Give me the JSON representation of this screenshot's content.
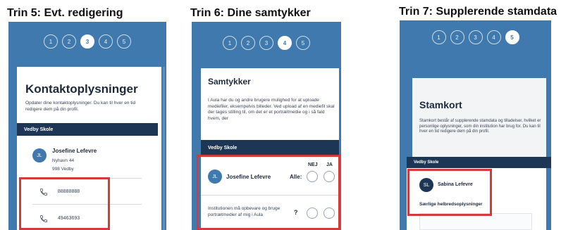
{
  "panels": [
    {
      "step_title": "Trin 5: Evt. redigering",
      "steps": [
        "1",
        "2",
        "3",
        "4",
        "5"
      ],
      "active_step": "3",
      "card_title": "Kontaktoplysninger",
      "card_body": "Opdater dine kontaktoplysninger. Du kan til hver en tid redigere dem på din profil.",
      "school": "Vedby Skole",
      "avatar_initials": "JL",
      "name": "Josefine Lefevre",
      "address_line1": "Nyhavn 44",
      "address_line2": "998 Vedby",
      "phone_numbers": [
        "88888888",
        "49463693"
      ],
      "icons": [
        "phone-icon",
        "phone-icon"
      ]
    },
    {
      "step_title": "Trin 6: Dine samtykker",
      "steps": [
        "1",
        "2",
        "3",
        "4",
        "5"
      ],
      "active_step": "4",
      "card_title": "Samtykker",
      "card_body": "I Aula har du og andre brugere mulighed for at uploade mediefiler, eksempelvis billeder. Ved upload af en mediefil skal der tages stilling til, om det er et portrætmedie og i så fald hvem, der",
      "school": "Vedby Skole",
      "col_no": "NEJ",
      "col_yes": "JA",
      "avatar_initials": "JL",
      "name": "Josefine Lefevre",
      "all_label": "Alle:",
      "question": "Institutionen må opbevare og bruge portrætmedier af mig i Aula",
      "question_mark": "?"
    },
    {
      "step_title": "Trin 7: Supplerende stamdata",
      "steps": [
        "1",
        "2",
        "3",
        "4",
        "5"
      ],
      "active_step": "5",
      "card_title": "Stamkort",
      "card_body": "Stamkort består af supplerende stamdata og tilladelser, hvilket er personlige oplysninger, som din institution har brug for. Du kan til hver en tid redigere dem på din profil.",
      "school": "Vedby Skole",
      "avatar_initials": "SL",
      "name": "Sabina Lefevre",
      "section": "Særlige helbredsoplysninger"
    }
  ],
  "colors": {
    "brand_blue": "#3f79ad",
    "navy": "#1d3656",
    "highlight_red": "#d33a3a"
  }
}
